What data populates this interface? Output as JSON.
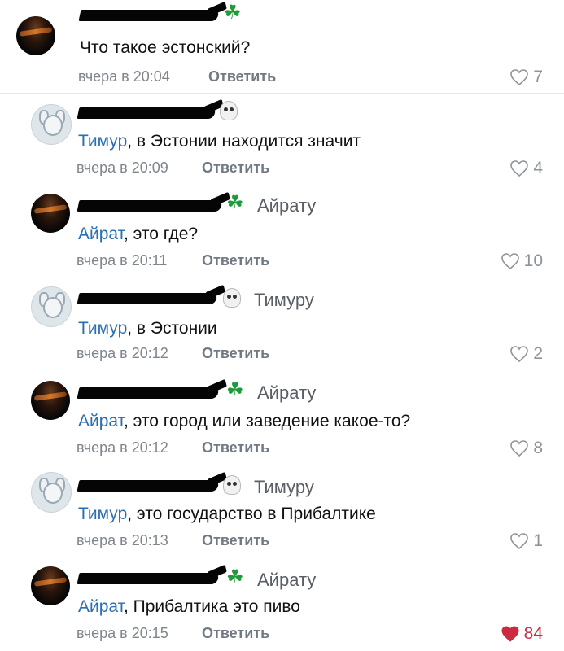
{
  "comments": [
    {
      "reply_to": "",
      "mention": "",
      "text": "Что такое эстонский?",
      "time": "вчера в 20:04",
      "reply_label": "Ответить",
      "likes": "7",
      "liked": false,
      "emoji": "clover-icon",
      "avatar": "dark-avatar"
    },
    {
      "reply_to": "",
      "mention": "Тимур",
      "text": ", в Эстонии находится значит",
      "time": "вчера в 20:09",
      "reply_label": "Ответить",
      "likes": "4",
      "liked": false,
      "emoji": "skull-icon",
      "avatar": "sticker-avatar"
    },
    {
      "reply_to": "Айрату",
      "mention": "Айрат",
      "text": ", это где?",
      "time": "вчера в 20:11",
      "reply_label": "Ответить",
      "likes": "10",
      "liked": false,
      "emoji": "clover-icon",
      "avatar": "dark-avatar"
    },
    {
      "reply_to": "Тимуру",
      "mention": "Тимур",
      "text": ", в Эстонии",
      "time": "вчера в 20:12",
      "reply_label": "Ответить",
      "likes": "2",
      "liked": false,
      "emoji": "skull-icon",
      "avatar": "sticker-avatar"
    },
    {
      "reply_to": "Айрату",
      "mention": "Айрат",
      "text": ", это город или заведение какое-то?",
      "time": "вчера в 20:12",
      "reply_label": "Ответить",
      "likes": "8",
      "liked": false,
      "emoji": "clover-icon",
      "avatar": "dark-avatar"
    },
    {
      "reply_to": "Тимуру",
      "mention": "Тимур",
      "text": ", это государство в Прибалтике",
      "time": "вчера в 20:13",
      "reply_label": "Ответить",
      "likes": "1",
      "liked": false,
      "emoji": "skull-icon",
      "avatar": "sticker-avatar"
    },
    {
      "reply_to": "Айрату",
      "mention": "Айрат",
      "text": ", Прибалтика это пиво",
      "time": "вчера в 20:15",
      "reply_label": "Ответить",
      "likes": "84",
      "liked": true,
      "emoji": "clover-icon",
      "avatar": "dark-avatar"
    }
  ],
  "colors": {
    "mention": "#2a6fb3",
    "like_active": "#cc2b3f",
    "like_inactive": "#8e949a"
  }
}
